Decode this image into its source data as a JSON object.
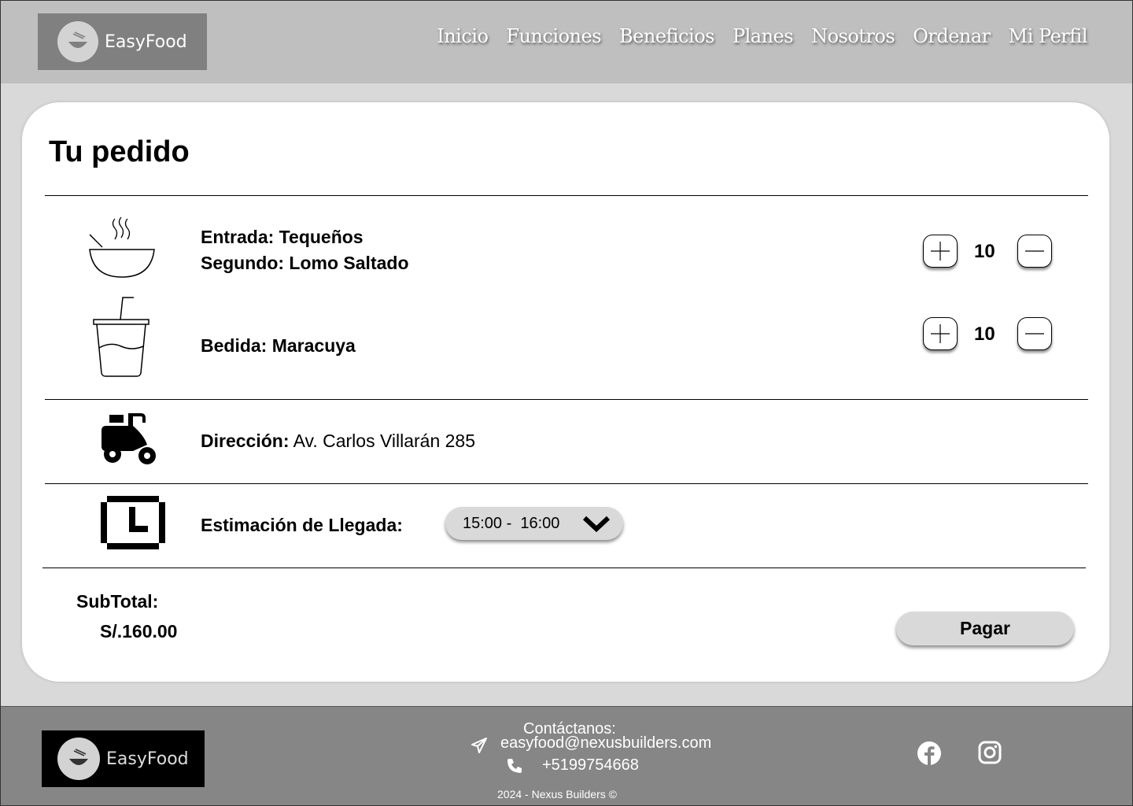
{
  "brand": {
    "name": "EasyFood"
  },
  "nav": {
    "items": [
      "Inicio",
      "Funciones",
      "Beneficios",
      "Planes",
      "Nosotros",
      "Ordenar",
      "Mi Perfil"
    ]
  },
  "order": {
    "title": "Tu pedido",
    "items": [
      {
        "lines": [
          "Entrada: Tequeños",
          "Segundo: Lomo Saltado"
        ],
        "icon": "soup-bowl-icon",
        "quantity": "10"
      },
      {
        "lines": [
          "Bedida: Maracuya"
        ],
        "icon": "drink-cup-icon",
        "quantity": "10"
      }
    ],
    "address": {
      "label": "Dirección:",
      "value": "Av. Carlos Villarán 285",
      "icon": "scooter-icon"
    },
    "eta": {
      "label": "Estimación de Llegada:",
      "selected": "15:00 -  16:00",
      "icon": "clock-icon"
    },
    "subtotal": {
      "label": "SubTotal:",
      "value": "S/.160.00"
    },
    "pay_label": "Pagar"
  },
  "footer": {
    "contact_label": "Contáctanos:",
    "email": "easyfood@nexusbuilders.com",
    "phone": "+5199754668",
    "copyright": "2024 - Nexus Builders ©",
    "social": [
      "facebook-icon",
      "instagram-icon"
    ]
  },
  "colors": {
    "header_bg": "#bfbfbf",
    "page_bg": "#d9d9d9",
    "footer_bg": "#868686",
    "card_bg": "#ffffff"
  }
}
